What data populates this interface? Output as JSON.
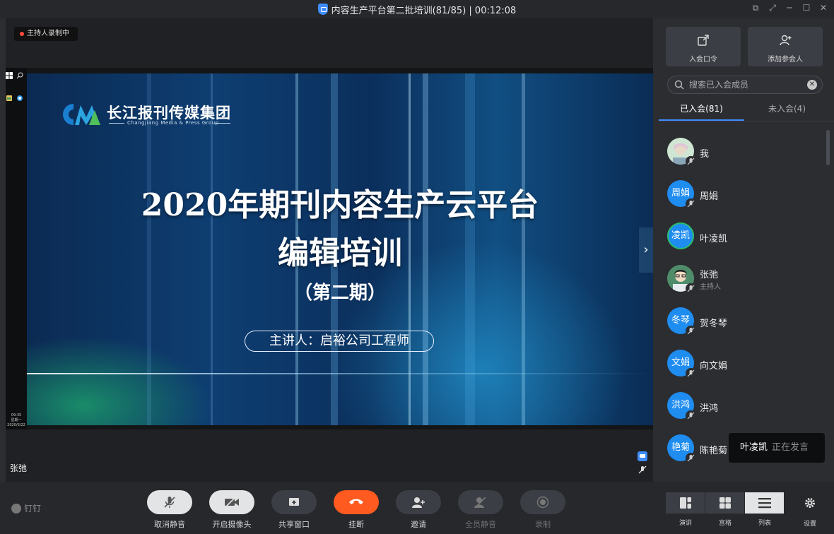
{
  "window": {
    "title": "内容生产平台第二批培训(81/85) | 00:12:08"
  },
  "recording_badge": "主持人录制中",
  "shared_screen": {
    "taskbar_time": "09:35",
    "taskbar_weekday": "星期一",
    "taskbar_date": "2020/6/22",
    "slide": {
      "logo_cn": "长江报刊传媒集团",
      "logo_en": "Changjiang Media & Press Group",
      "title_line1": "2020年期刊内容生产云平台",
      "title_line2": "编辑培训",
      "title_line3": "（第二期）",
      "speaker": "主讲人：启裕公司工程师"
    }
  },
  "current_speaker_label": "张弛",
  "sidebar": {
    "join_code_label": "入会口令",
    "add_participant_label": "添加参会人",
    "search_placeholder": "搜索已入会成员",
    "tabs": [
      {
        "label": "已入会(81)",
        "active": true
      },
      {
        "label": "未入会(4)",
        "active": false
      }
    ],
    "members": [
      {
        "avatar_text": "",
        "name": "我",
        "role": "",
        "photo": true
      },
      {
        "avatar_text": "周娟",
        "name": "周娟",
        "role": ""
      },
      {
        "avatar_text": "凌凯",
        "name": "叶凌凯",
        "role": "",
        "speaking_ring": true
      },
      {
        "avatar_text": "",
        "name": "张弛",
        "role": "主持人",
        "photo": true
      },
      {
        "avatar_text": "冬琴",
        "name": "贺冬琴",
        "role": ""
      },
      {
        "avatar_text": "文娟",
        "name": "向文娟",
        "role": ""
      },
      {
        "avatar_text": "洪鸿",
        "name": "洪鸿",
        "role": ""
      },
      {
        "avatar_text": "艳菊",
        "name": "陈艳菊",
        "role": ""
      }
    ]
  },
  "speaking_toast": {
    "name": "叶凌凯",
    "status": "正在发言"
  },
  "toolbar": {
    "brand": "钉钉",
    "unmute_label": "取消静音",
    "camera_label": "开启摄像头",
    "share_label": "共享窗口",
    "hangup_label": "挂断",
    "invite_label": "邀请",
    "mute_all_label": "全员静音",
    "record_label": "录制",
    "view_speaker_label": "演讲",
    "view_grid_label": "宫格",
    "view_list_label": "列表",
    "settings_label": "设置"
  },
  "colors": {
    "accent": "#3f8cff",
    "hangup": "#ff5a1f",
    "avatar": "#1f8cf0"
  }
}
